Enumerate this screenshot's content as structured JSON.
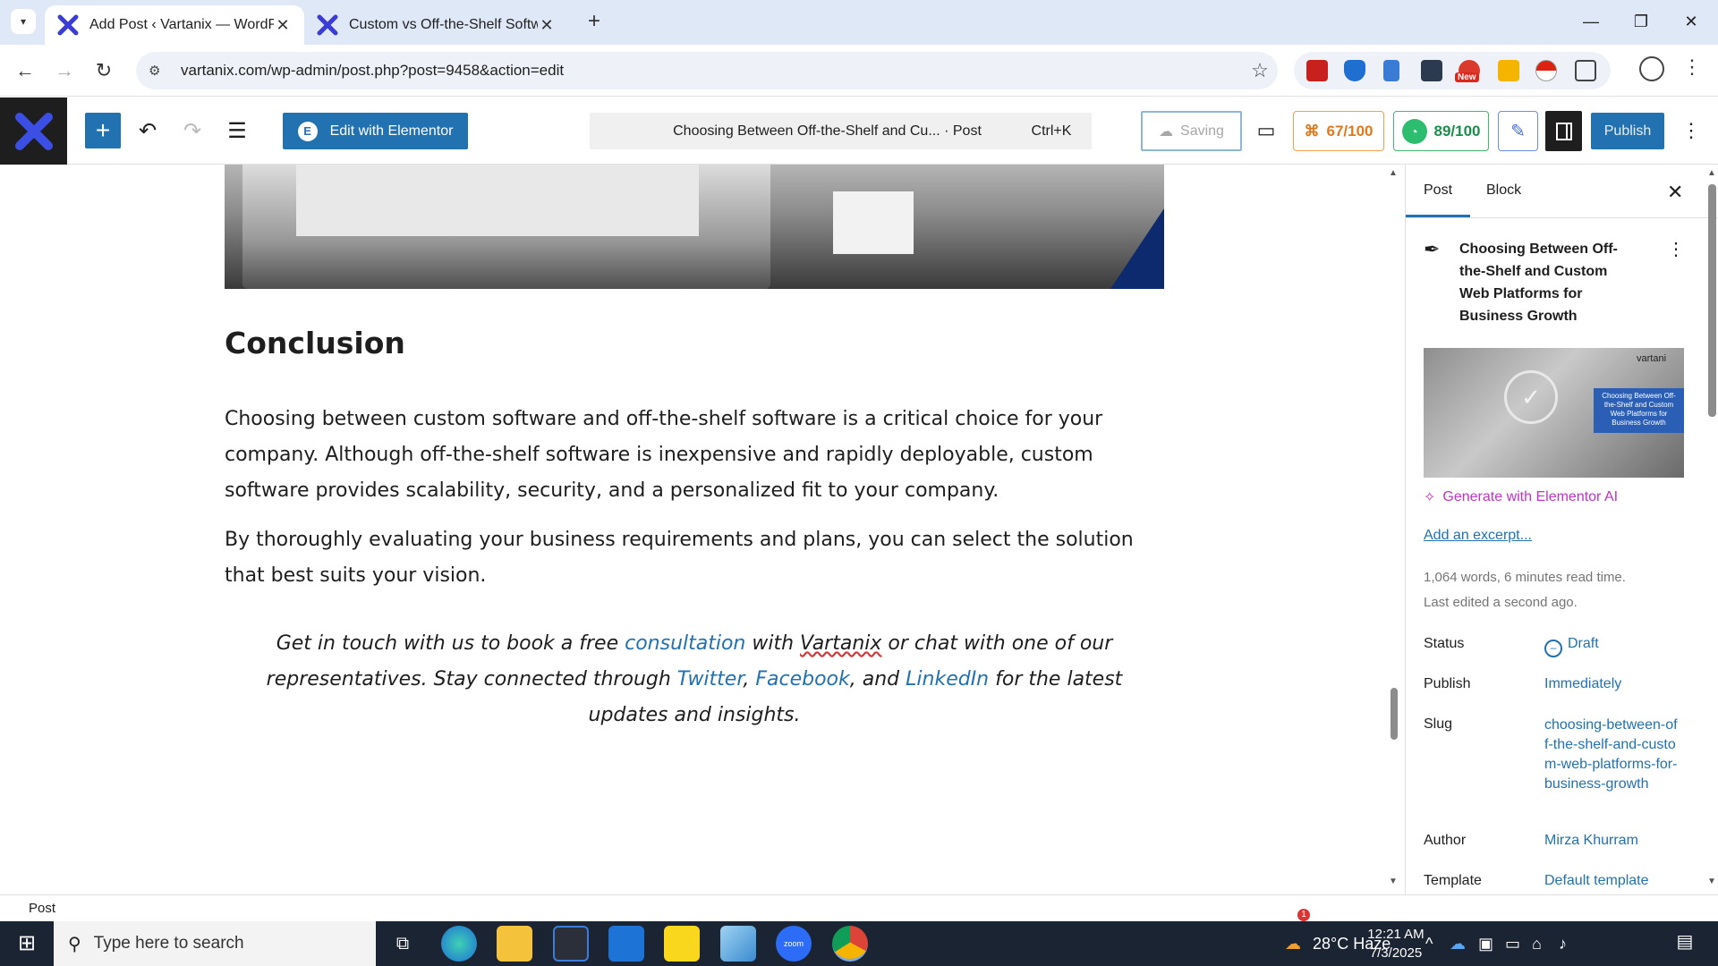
{
  "browser": {
    "tabs": [
      {
        "title": "Add Post ‹ Vartanix — WordPre",
        "active": true
      },
      {
        "title": "Custom vs Off-the-Shelf Softwa",
        "active": false
      }
    ],
    "url": "vartanix.com/wp-admin/post.php?post=9458&action=edit",
    "extensions": [
      "pdf-icon",
      "shield-extension-icon",
      "document-icon",
      "folder-icon",
      "new-badge-extension-icon",
      "star-extension-icon",
      "pokeball-icon",
      "puzzle-icon"
    ],
    "new_badge": "New"
  },
  "wp_header": {
    "elementor_label": "Edit with Elementor",
    "command_title": "Choosing Between Off-the-Shelf and Cu... · Post",
    "command_shortcut": "Ctrl+K",
    "saving_label": "Saving",
    "score1": "67/100",
    "score2": "89/100",
    "publish_label": "Publish"
  },
  "content": {
    "heading": "Conclusion",
    "para1": "Choosing between custom software and off-the-shelf software is a critical choice for your company. Although off-the-shelf software is inexpensive and rapidly deployable, custom software provides scalability, security, and a personalized fit to your company.",
    "para2": "By thoroughly evaluating your business requirements and plans, you can select the solution that best suits your vision.",
    "cta": {
      "part1": "Get in touch with us to book a free ",
      "link1": "consultation",
      "part2": " with ",
      "brand": "Vartanix",
      "part3": " or chat with one of our representatives. Stay connected through ",
      "link2": "Twitter",
      "sep1": ", ",
      "link3": "Facebook",
      "sep2": ", and ",
      "link4": "LinkedIn",
      "part4": " for the latest updates and insights."
    }
  },
  "sidebar": {
    "tab_post": "Post",
    "tab_block": "Block",
    "post_title": "Choosing Between Off-the-Shelf and Custom Web Platforms for Business Growth",
    "thumb_brand": "vartani",
    "thumb_caption": "Choosing Between Off-the-Shelf and Custom Web Platforms for Business Growth",
    "generate_ai": "Generate with Elementor AI",
    "add_excerpt": "Add an excerpt...",
    "word_count": "1,064 words, 6 minutes read time.",
    "last_edited": "Last edited a second ago.",
    "rows": {
      "status_label": "Status",
      "status_value": "Draft",
      "publish_label": "Publish",
      "publish_value": "Immediately",
      "slug_label": "Slug",
      "slug_value": "choosing-between-off-the-shelf-and-custom-web-platforms-for-business-growth",
      "author_label": "Author",
      "author_value": "Mirza Khurram",
      "template_label": "Template",
      "template_value": "Default template"
    }
  },
  "footer": {
    "breadcrumb": "Post"
  },
  "taskbar": {
    "search_placeholder": "Type here to search",
    "weather": "28°C  Haze",
    "time": "12:21 AM",
    "date": "7/3/2025",
    "notification_count": "1"
  }
}
